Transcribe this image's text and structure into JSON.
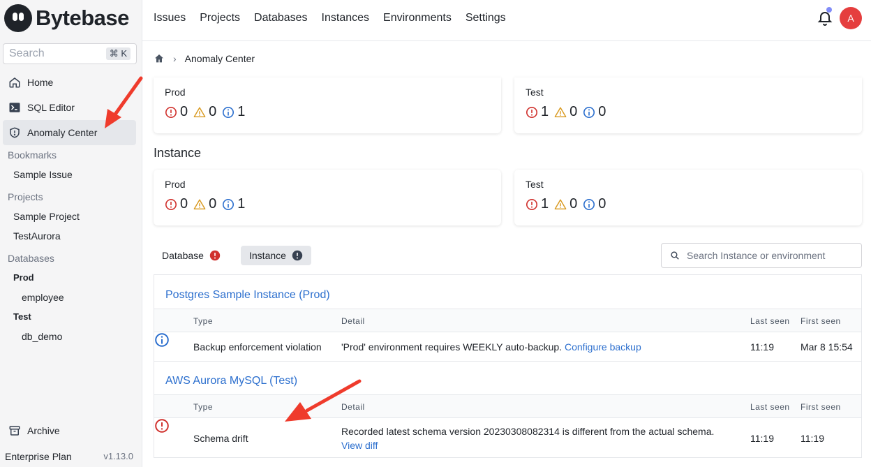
{
  "app": {
    "name": "Bytebase",
    "version": "v1.13.0",
    "plan": "Enterprise Plan"
  },
  "search": {
    "placeholder": "Search",
    "shortcut": "⌘ K"
  },
  "sidebar": {
    "nav": [
      {
        "label": "Home",
        "icon": "home-icon"
      },
      {
        "label": "SQL Editor",
        "icon": "terminal-icon"
      },
      {
        "label": "Anomaly Center",
        "icon": "shield-icon",
        "active": true
      }
    ],
    "bookmarks_label": "Bookmarks",
    "bookmarks": [
      "Sample Issue"
    ],
    "projects_label": "Projects",
    "projects": [
      "Sample Project",
      "TestAurora"
    ],
    "databases_label": "Databases",
    "database_groups": [
      {
        "env": "Prod",
        "databases": [
          "employee"
        ]
      },
      {
        "env": "Test",
        "databases": [
          "db_demo"
        ]
      }
    ],
    "archive_label": "Archive"
  },
  "topnav": [
    "Issues",
    "Projects",
    "Databases",
    "Instances",
    "Environments",
    "Settings"
  ],
  "user": {
    "avatar_initial": "A"
  },
  "breadcrumb": {
    "current": "Anomaly Center"
  },
  "summary": {
    "database_cards": [
      {
        "env": "Prod",
        "critical": "0",
        "warning": "0",
        "info": "1"
      },
      {
        "env": "Test",
        "critical": "1",
        "warning": "0",
        "info": "0"
      }
    ],
    "instance_title": "Instance",
    "instance_cards": [
      {
        "env": "Prod",
        "critical": "0",
        "warning": "0",
        "info": "1"
      },
      {
        "env": "Test",
        "critical": "1",
        "warning": "0",
        "info": "0"
      }
    ]
  },
  "tabs": [
    {
      "label": "Database",
      "active": false
    },
    {
      "label": "Instance",
      "active": true
    }
  ],
  "filter": {
    "placeholder": "Search Instance or environment"
  },
  "columns": {
    "type": "Type",
    "detail": "Detail",
    "last_seen": "Last seen",
    "first_seen": "First seen"
  },
  "groups": [
    {
      "title": "Postgres Sample Instance (Prod)",
      "rows": [
        {
          "severity": "info",
          "type": "Backup enforcement violation",
          "detail": "'Prod' environment requires WEEKLY auto-backup.",
          "action": "Configure backup",
          "last_seen": "11:19",
          "first_seen": "Mar 8 15:54"
        }
      ]
    },
    {
      "title": "AWS Aurora MySQL (Test)",
      "rows": [
        {
          "severity": "critical",
          "type": "Schema drift",
          "detail": "Recorded latest schema version 20230308082314 is different from the actual schema.",
          "action": "View diff",
          "last_seen": "11:19",
          "first_seen": "11:19"
        }
      ]
    }
  ],
  "colors": {
    "critical": "#d0312d",
    "warning": "#d99a21",
    "info": "#2c6fce",
    "link": "#2c6fce",
    "annotation_arrow": "#ef3b2c"
  }
}
